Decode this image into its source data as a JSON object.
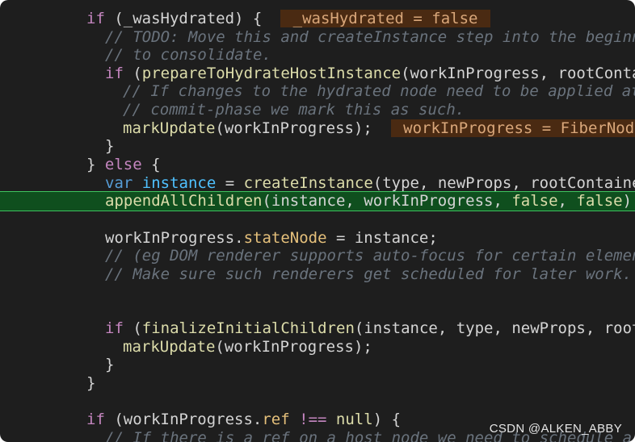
{
  "lines": [
    {
      "id": "l1",
      "parts": [
        {
          "t": "if",
          "c": "kw"
        },
        {
          "t": " (_wasHydrated) {  "
        },
        {
          "t": " _wasHydrated = false ",
          "c": "hint"
        }
      ]
    },
    {
      "id": "l2",
      "parts": [
        {
          "t": "// TODO: Move this and createInstance step into the beginn",
          "c": "cmt"
        }
      ]
    },
    {
      "id": "l3",
      "parts": [
        {
          "t": "// to consolidate.",
          "c": "cmt"
        }
      ]
    },
    {
      "id": "l4",
      "parts": [
        {
          "t": "if",
          "c": "kw"
        },
        {
          "t": " ("
        },
        {
          "t": "prepareToHydrateHostInstance",
          "c": "fn"
        },
        {
          "t": "(workInProgress, rootContai"
        }
      ]
    },
    {
      "id": "l5",
      "parts": [
        {
          "t": "// If changes to the hydrated node need to be applied at",
          "c": "cmt"
        }
      ]
    },
    {
      "id": "l6",
      "parts": [
        {
          "t": "// commit-phase we mark this as such.",
          "c": "cmt"
        }
      ]
    },
    {
      "id": "l7",
      "parts": [
        {
          "t": "markUpdate",
          "c": "fn"
        },
        {
          "t": "(workInProgress);  "
        },
        {
          "t": " workInProgress = FiberNode",
          "c": "hint"
        }
      ]
    },
    {
      "id": "l8",
      "parts": [
        {
          "t": "}"
        }
      ]
    },
    {
      "id": "l9",
      "parts": [
        {
          "t": "} "
        },
        {
          "t": "else",
          "c": "kw"
        },
        {
          "t": " {"
        }
      ]
    },
    {
      "id": "l10",
      "parts": [
        {
          "t": "var",
          "c": "kw2"
        },
        {
          "t": " "
        },
        {
          "t": "instance",
          "c": "var"
        },
        {
          "t": " = "
        },
        {
          "t": "createInstance",
          "c": "fn"
        },
        {
          "t": "(type, newProps, rootContaine"
        }
      ]
    },
    {
      "id": "l11",
      "parts": [
        {
          "t": "appendAllChildren",
          "c": "fn"
        },
        {
          "t": "(instance, workInProgress, "
        },
        {
          "t": "false",
          "c": "bool"
        },
        {
          "t": ", "
        },
        {
          "t": "false",
          "c": "bool"
        },
        {
          "t": ")"
        }
      ]
    },
    {
      "id": "l12",
      "parts": [
        {
          "t": "workInProgress."
        },
        {
          "t": "stateNode",
          "c": "prop"
        },
        {
          "t": " = instance;"
        }
      ]
    },
    {
      "id": "l13",
      "parts": [
        {
          "t": "// (eg DOM renderer supports auto-focus for certain elemen",
          "c": "cmt"
        }
      ]
    },
    {
      "id": "l14",
      "parts": [
        {
          "t": "// Make sure such renderers get scheduled for later work.",
          "c": "cmt"
        }
      ]
    },
    {
      "id": "l15",
      "parts": [
        {
          "t": "if",
          "c": "kw"
        },
        {
          "t": " ("
        },
        {
          "t": "finalizeInitialChildren",
          "c": "fn"
        },
        {
          "t": "(instance, type, newProps, root"
        }
      ]
    },
    {
      "id": "l16",
      "parts": [
        {
          "t": "markUpdate",
          "c": "fn"
        },
        {
          "t": "(workInProgress);"
        }
      ]
    },
    {
      "id": "l17",
      "parts": [
        {
          "t": "}"
        }
      ]
    },
    {
      "id": "l18",
      "parts": [
        {
          "t": "}"
        }
      ]
    },
    {
      "id": "l19",
      "parts": [
        {
          "t": "if",
          "c": "kw"
        },
        {
          "t": " (workInProgress."
        },
        {
          "t": "ref",
          "c": "prop"
        },
        {
          "t": " "
        },
        {
          "t": "!==",
          "c": "kw"
        },
        {
          "t": " "
        },
        {
          "t": "null",
          "c": "bool"
        },
        {
          "t": ") {"
        }
      ]
    },
    {
      "id": "l20",
      "parts": [
        {
          "t": "// If there is a ref on a host node we need to schedule a",
          "c": "cmt"
        }
      ]
    }
  ],
  "watermark": "CSDN @ALKEN_ABBY"
}
